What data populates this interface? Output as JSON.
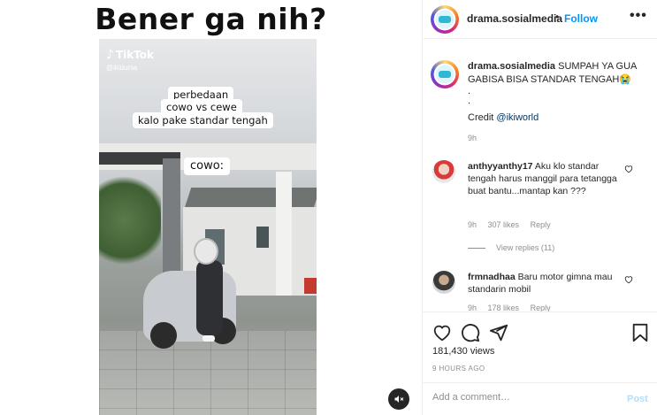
{
  "media": {
    "title": "Bener ga nih?",
    "tiktok_logo": "TikTok",
    "tiktok_user": "@ikidunia",
    "text_line1": "perbedaan",
    "text_line2": "cowo vs cewe",
    "text_line3": "kalo pake standar tengah",
    "text_cowo": "cowo:",
    "mute_icon": "speaker-muted-icon"
  },
  "header": {
    "username": "drama.sosialmedia",
    "separator": "•",
    "follow_label": "Follow",
    "more_label": "•••"
  },
  "caption": {
    "username": "drama.sosialmedia",
    "text": "SUMPAH YA GUA GABISA BISA STANDAR TENGAH😭",
    "dot1": ".",
    "dot2": ".",
    "credit_label": "Credit",
    "credit_link": "@ikiworld",
    "time": "9h"
  },
  "comments": [
    {
      "username": "anthyyanthy17",
      "text": "Aku klo standar tengah harus manggil para tetangga buat bantu...mantap kan ???",
      "time": "9h",
      "likes": "307 likes",
      "reply": "Reply",
      "view_replies": "View replies (11)"
    },
    {
      "username": "frmnadhaa",
      "text": "Baru motor gimna mau standarin mobil",
      "time": "9h",
      "likes": "178 likes",
      "reply": "Reply"
    }
  ],
  "actions": {
    "likes_count": "181,430 views",
    "time_ago": "9 HOURS AGO"
  },
  "add_comment": {
    "placeholder": "Add a comment…",
    "post_label": "Post"
  },
  "colors": {
    "follow_blue": "#0095f6",
    "post_disabled": "#b2dffc",
    "muted_text": "#8e8e8e"
  }
}
